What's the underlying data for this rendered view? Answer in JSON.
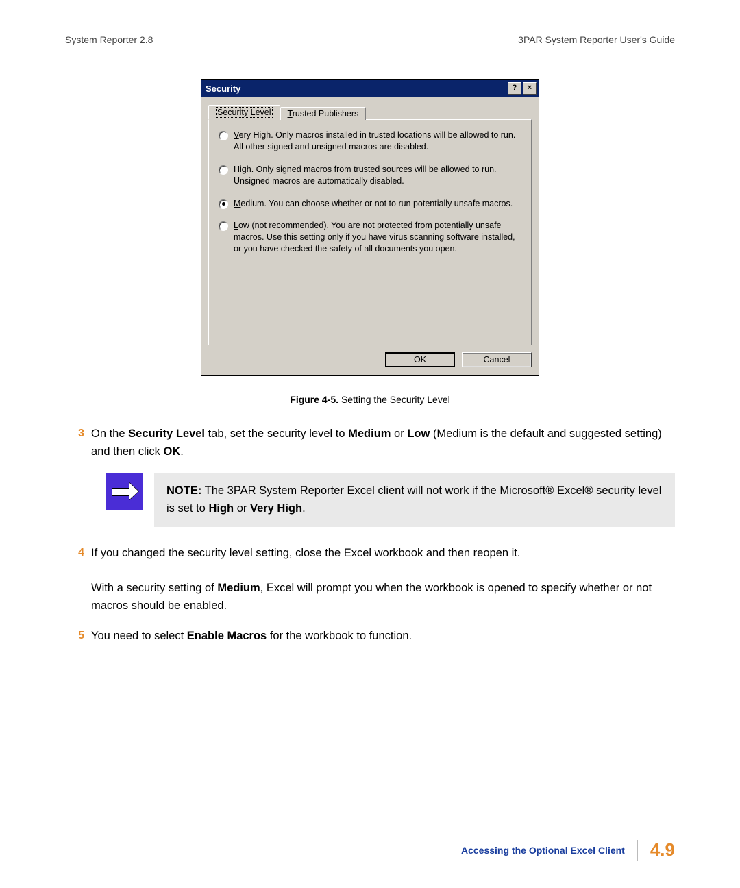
{
  "header": {
    "left": "System Reporter 2.8",
    "right": "3PAR System Reporter User's Guide"
  },
  "dialog": {
    "title": "Security",
    "help_glyph": "?",
    "close_glyph": "×",
    "tabs": {
      "security_level_pre": "S",
      "security_level_post": "ecurity Level",
      "trusted_pre": "T",
      "trusted_post": "rusted Publishers"
    },
    "options": {
      "very_high_pre": "V",
      "very_high_post": "ery High. Only macros installed in trusted locations will be allowed to run. All other signed and unsigned macros are disabled.",
      "high_pre": "H",
      "high_post": "igh. Only signed macros from trusted sources will be allowed to run. Unsigned macros are automatically disabled.",
      "medium_pre": "M",
      "medium_post": "edium. You can choose whether or not to run potentially unsafe macros.",
      "low_pre": "L",
      "low_post": "ow (not recommended). You are not protected from potentially unsafe macros. Use this setting only if you have virus scanning software installed, or you have checked the safety of all documents you open."
    },
    "buttons": {
      "ok": "OK",
      "cancel": "Cancel"
    }
  },
  "figure": {
    "label": "Figure 4-5. ",
    "text": "Setting the Security Level"
  },
  "steps": {
    "s3_num": "3",
    "s3_a": "On the ",
    "s3_b": "Security Level",
    "s3_c": " tab, set the security level to ",
    "s3_d": "Medium",
    "s3_e": " or ",
    "s3_f": "Low",
    "s3_g": " (Medium is the default and suggested setting) and then click ",
    "s3_h": "OK",
    "s3_i": ".",
    "s4_num": "4",
    "s4_a": "If you changed the security level setting, close the Excel workbook and then reopen it.",
    "s4_b_a": "With a security setting of ",
    "s4_b_b": "Medium",
    "s4_b_c": ", Excel will prompt you when the workbook is opened to specify whether or not macros should be enabled.",
    "s5_num": "5",
    "s5_a": "You need to select ",
    "s5_b": "Enable Macros",
    "s5_c": " for the workbook to function."
  },
  "note": {
    "label": "NOTE:",
    "a": " The 3PAR System Reporter Excel client will not work if the Microsoft® Excel® security level is set to ",
    "b": "High",
    "c": " or ",
    "d": "Very High",
    "e": "."
  },
  "footer": {
    "link": "Accessing the Optional Excel Client",
    "page": "4.9"
  }
}
